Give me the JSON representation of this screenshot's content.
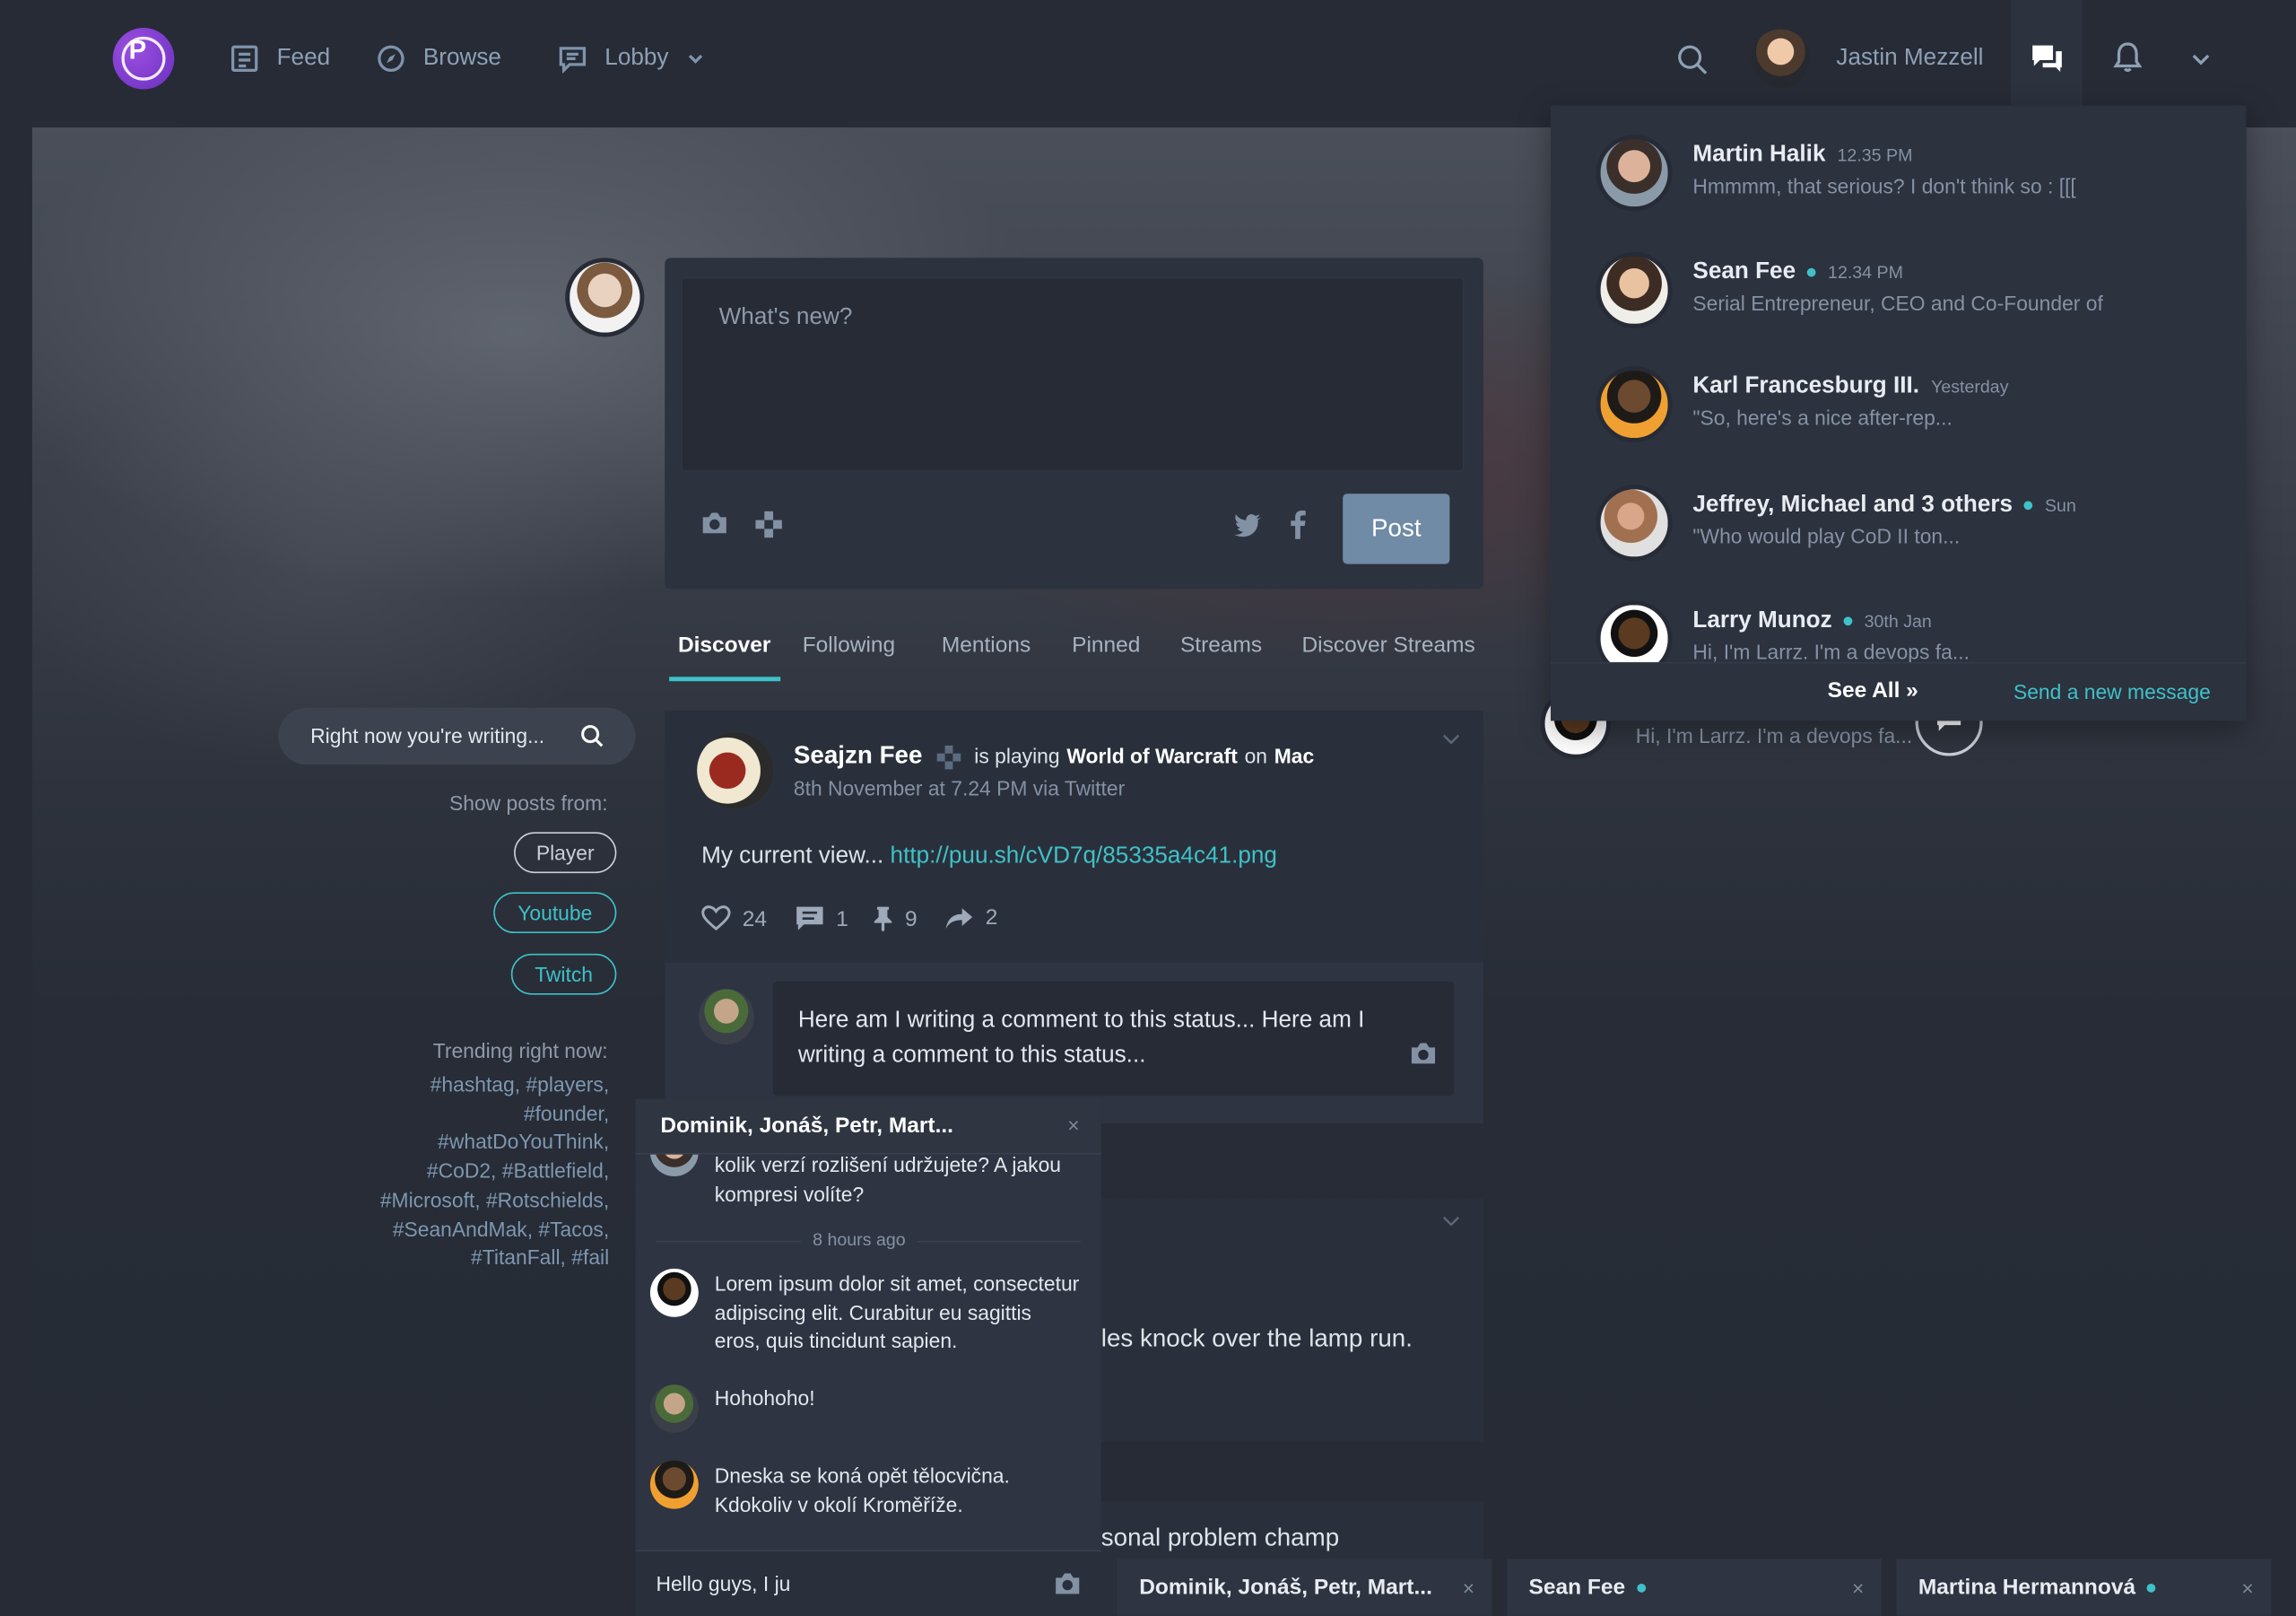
{
  "nav": {
    "items": [
      {
        "label": "Feed",
        "icon": "feed-icon"
      },
      {
        "label": "Browse",
        "icon": "compass-icon"
      },
      {
        "label": "Lobby",
        "icon": "lobby-icon"
      }
    ],
    "user_name": "Jastin Mezzell",
    "logo_letter": "P"
  },
  "composer": {
    "placeholder": "What's new?",
    "post_label": "Post"
  },
  "tabs": [
    "Discover",
    "Following",
    "Mentions",
    "Pinned",
    "Streams",
    "Discover Streams"
  ],
  "post": {
    "author": "Seajzn Fee",
    "activity_prefix": "is playing",
    "game": "World of Warcraft",
    "on_word": "on",
    "platform": "Mac",
    "meta": "8th November at 7.24 PM  via Twitter",
    "text": "My current view... ",
    "link": "http://puu.sh/cVD7q/85335a4c41.png",
    "stats": {
      "likes": "24",
      "comments": "1",
      "pins": "9",
      "shares": "2"
    },
    "comment_draft": "Here am I writing a comment to this status... Here am I writing a comment to this status..."
  },
  "post2_fragment": "les knock over the lamp run.",
  "post3_fragment": "sonal problem champ",
  "sidebar": {
    "search_placeholder": "Right now you're writing...",
    "show_posts_label": "Show posts from:",
    "filters": [
      {
        "label": "Player",
        "color": "#c9ced8"
      },
      {
        "label": "Youtube",
        "color": "#3fc1c9"
      },
      {
        "label": "Twitch",
        "color": "#3fc1c9"
      }
    ],
    "trending_label": "Trending right now:",
    "hashtags": [
      "#hashtag, #players,",
      "#founder,",
      "#whatDoYouThink,",
      "#CoD2, #Battlefield,",
      "#Microsoft, #Rotschields,",
      "#SeanAndMak, #Tacos,",
      "#TitanFall, #fail"
    ]
  },
  "messages": {
    "items": [
      {
        "name": "Martin Halik",
        "time": "12.35 PM",
        "preview": "Hmmmm, that serious? I don't think so : [[[",
        "online": false
      },
      {
        "name": "Sean Fee",
        "time": "12.34 PM",
        "preview": "Serial Entrepreneur, CEO and Co-Founder of",
        "online": true
      },
      {
        "name": "Karl Francesburg III.",
        "time": "Yesterday",
        "preview": "\"So, here's a nice after-rep...",
        "online": false
      },
      {
        "name": "Jeffrey, Michael and 3 others",
        "time": "Sun",
        "preview": "\"Who would play CoD II ton...",
        "online": true
      },
      {
        "name": "Larry Munoz",
        "time": "30th Jan",
        "preview": "Hi, I'm Larrz. I'm a devops fa...",
        "online": true
      }
    ],
    "see_all": "See All »",
    "send_new": "Send a new message",
    "behind_preview": "Hi, I'm Larrz. I'm a devops fa..."
  },
  "chat": {
    "title": "Dominik, Jonáš, Petr, Mart...",
    "close": "×",
    "partial_msg": "kolik verzí rozlišení udržujete? A jakou kompresi volíte?",
    "divider": "8 hours ago",
    "messages": [
      "Lorem ipsum dolor sit amet, consectetur adipiscing elit. Curabitur eu sagittis eros, quis tincidunt sapien.",
      "Hohohoho!",
      "Dneska se koná opět tělocvična. Kdokoliv v okolí Kroměříže."
    ],
    "input_value": "Hello guys, I ju"
  },
  "bottom_tabs": [
    {
      "label": "Dominik, Jonáš, Petr, Mart...",
      "online": false
    },
    {
      "label": "Sean Fee",
      "online": true
    },
    {
      "label": "Martina Hermannová",
      "online": true
    }
  ],
  "colors": {
    "accent": "#3fc1c9",
    "background": "#262b36",
    "panel": "#2c323e",
    "post_button": "#6f8ba6"
  }
}
